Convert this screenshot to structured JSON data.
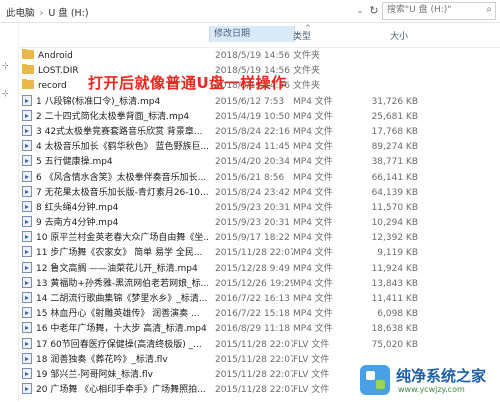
{
  "breadcrumb": [
    "此电脑",
    "U 盘 (H:)"
  ],
  "search": {
    "placeholder": "搜索\"U 盘 (H:)\""
  },
  "columns": {
    "date": "修改日期",
    "type": "类型",
    "size": "大小"
  },
  "annotation": "打开后就像普通U盘一样操作",
  "files": [
    {
      "icon": "folder-icon",
      "name": "Android",
      "date": "2018/5/19 14:56",
      "type": "文件夹",
      "size": ""
    },
    {
      "icon": "folder-icon",
      "name": "LOST.DIR",
      "date": "2018/5/19 14:56",
      "type": "文件夹",
      "size": ""
    },
    {
      "icon": "folder-icon",
      "name": "record",
      "date": "2018/5/19 14:56",
      "type": "文件夹",
      "size": ""
    },
    {
      "icon": "media-file-icon",
      "name": "1 八段锦(标准口令)_标清.mp4",
      "date": "2015/6/12 7:53",
      "type": "MP4 文件",
      "size": "31,726 KB"
    },
    {
      "icon": "media-file-icon",
      "name": "2 二十四式简化太极拳背面_标清.mp4",
      "date": "2015/4/19 10:50",
      "type": "MP4 文件",
      "size": "25,681 KB"
    },
    {
      "icon": "media-file-icon",
      "name": "3 42式太极拳竞赛套路音乐欣赏 背景章...",
      "date": "2015/8/24 22:16",
      "type": "MP4 文件",
      "size": "17,768 KB"
    },
    {
      "icon": "media-file-icon",
      "name": "4 太极音乐加长《鹤华秋色》 蓝色野族巨...",
      "date": "2015/8/24 11:45",
      "type": "MP4 文件",
      "size": "89,274 KB"
    },
    {
      "icon": "media-file-icon",
      "name": "5 五行健康操.mp4",
      "date": "2015/4/20 20:34",
      "type": "MP4 文件",
      "size": "38,771 KB"
    },
    {
      "icon": "media-file-icon",
      "name": "6 《风含情水含笑》太极拳伴奏音乐加长...",
      "date": "2015/6/21 8:56",
      "type": "MP4 文件",
      "size": "66,141 KB"
    },
    {
      "icon": "media-file-icon",
      "name": "7 无花果太极音乐加长版-青灯素月26-10...",
      "date": "2015/8/24 23:42",
      "type": "MP4 文件",
      "size": "64,139 KB"
    },
    {
      "icon": "media-file-icon",
      "name": "8 红头绳4分钟.mp4",
      "date": "2015/9/23 20:31",
      "type": "MP4 文件",
      "size": "11,570 KB"
    },
    {
      "icon": "media-file-icon",
      "name": "9 去南方4分钟.mp4",
      "date": "2015/9/23 20:31",
      "type": "MP4 文件",
      "size": "10,294 KB"
    },
    {
      "icon": "media-file-icon",
      "name": "10 原平兰村金英老春大众广场自由舞《坐...",
      "date": "2015/9/17 18:22",
      "type": "MP4 文件",
      "size": "12,392 KB"
    },
    {
      "icon": "media-file-icon",
      "name": "11 步广场舞《农家女》 简单 易学 全民...",
      "date": "2015/11/28 22:07",
      "type": "MP4 文件",
      "size": "9,119 KB"
    },
    {
      "icon": "media-file-icon",
      "name": "12 鲁文高搁 ——油菜花儿开_标清.mp4",
      "date": "2015/12/28 9:49",
      "type": "MP4 文件",
      "size": "11,924 KB"
    },
    {
      "icon": "media-file-icon",
      "name": "13 黄福助+孙秀雅-黑流网伯老若网娘_标...",
      "date": "2015/12/26 19:29",
      "type": "MP4 文件",
      "size": "13,843 KB"
    },
    {
      "icon": "media-file-icon",
      "name": "14 二胡流行歌曲集锦《梦里水乡》_标清...",
      "date": "2016/7/22 16:13",
      "type": "MP4 文件",
      "size": "11,411 KB"
    },
    {
      "icon": "media-file-icon",
      "name": "15 林血丹心《射雕英雄传》 润善演奏 ...",
      "date": "2016/7/22 15:18",
      "type": "MP4 文件",
      "size": "6,098 KB"
    },
    {
      "icon": "media-file-icon",
      "name": "16 中老年广场舞，十大步 高清_标清.mp4",
      "date": "2016/8/29 11:18",
      "type": "MP4 文件",
      "size": "18,638 KB"
    },
    {
      "icon": "media-file-icon",
      "name": "17 60节回春医疗保健操(高清终极版) _...",
      "date": "2015/11/28 22:07",
      "type": "FLV 文件",
      "size": "75,020 KB"
    },
    {
      "icon": "media-file-icon",
      "name": "18 润善独奏《葬花吟》_标清.flv",
      "date": "2015/11/28 22:07",
      "type": "FLV 文件",
      "size": ""
    },
    {
      "icon": "media-file-icon",
      "name": "19 邹兴兰-阿哥阿妹_标清.flv",
      "date": "2015/11/28 22:07",
      "type": "FLV 文件",
      "size": ""
    },
    {
      "icon": "media-file-icon",
      "name": "20 广场舞 《心相印手牵手》广场舞照拍...",
      "date": "2015/11/28 22:07",
      "type": "FLV 文件",
      "size": ""
    }
  ],
  "logo": {
    "title": "纯净系统之家",
    "url": "www.ycwjzy.com"
  }
}
